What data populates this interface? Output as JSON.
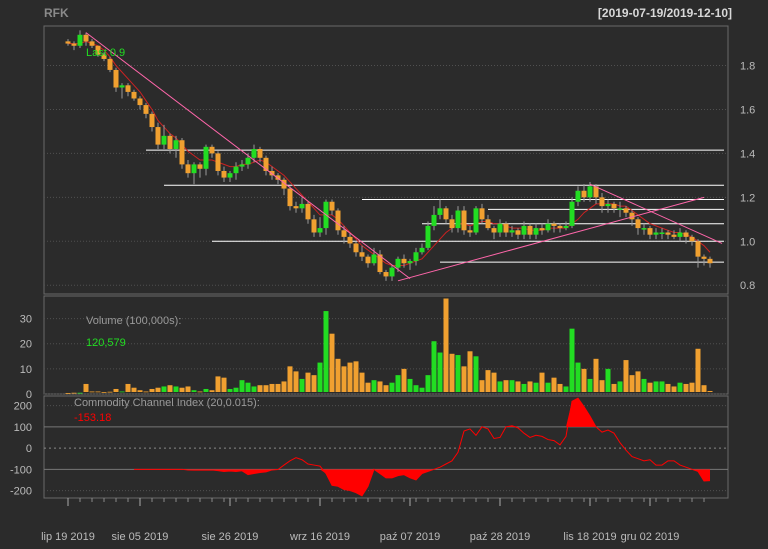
{
  "header": {
    "symbol": "RFK",
    "date_range": "[2019-07-19/2019-12-10]"
  },
  "colors": {
    "background": "#2b2b2b",
    "up": "#22dd22",
    "down": "#f0a030",
    "grid": "#505050",
    "axis_text": "#bbbbbb",
    "support_line": "#ffffff",
    "trend_line": "#ff66aa",
    "moving_average": "#cc2222",
    "cci_fill": "#ff0000"
  },
  "chart_data": [
    {
      "type": "candlestick",
      "panel": "price",
      "annotation": "Last 0.9",
      "y_ticks": [
        0.8,
        1.0,
        1.2,
        1.4,
        1.6,
        1.8
      ],
      "ylim": [
        0.76,
        1.98
      ],
      "grid": true,
      "x_tick_labels": [
        "lip 19 2019",
        "sie 05 2019",
        "sie 26 2019",
        "wrz 16 2019",
        "paź 07 2019",
        "paź 28 2019",
        "lis 18 2019",
        "gru 02 2019"
      ],
      "x_tick_index": [
        0,
        12,
        27,
        42,
        57,
        72,
        87,
        97
      ],
      "open": [
        1.91,
        1.9,
        1.89,
        1.94,
        1.91,
        1.89,
        1.85,
        1.83,
        1.78,
        1.7,
        1.71,
        1.68,
        1.65,
        1.62,
        1.58,
        1.52,
        1.44,
        1.48,
        1.42,
        1.46,
        1.35,
        1.31,
        1.35,
        1.33,
        1.43,
        1.4,
        1.32,
        1.29,
        1.31,
        1.34,
        1.35,
        1.38,
        1.42,
        1.38,
        1.32,
        1.3,
        1.28,
        1.24,
        1.16,
        1.15,
        1.17,
        1.1,
        1.04,
        1.06,
        1.18,
        1.14,
        1.05,
        1.02,
        0.99,
        0.95,
        0.93,
        0.9,
        0.94,
        0.86,
        0.84,
        0.88,
        0.92,
        0.9,
        0.91,
        0.95,
        0.97,
        1.07,
        1.12,
        1.15,
        1.1,
        1.06,
        1.14,
        1.05,
        1.04,
        1.15,
        1.1,
        1.06,
        1.04,
        1.08,
        1.04,
        1.05,
        1.03,
        1.07,
        1.03,
        1.06,
        1.05,
        1.08,
        1.07,
        1.06,
        1.07,
        1.18,
        1.23,
        1.2,
        1.25,
        1.2,
        1.16,
        1.17,
        1.15,
        1.15,
        1.13,
        1.1,
        1.06,
        1.06,
        1.03,
        1.04,
        1.04,
        1.03,
        1.02,
        1.04,
        1.02,
        1.0,
        0.93,
        0.92
      ],
      "high": [
        1.92,
        1.91,
        1.96,
        1.95,
        1.92,
        1.89,
        1.86,
        1.84,
        1.79,
        1.72,
        1.72,
        1.69,
        1.66,
        1.63,
        1.59,
        1.54,
        1.53,
        1.49,
        1.48,
        1.47,
        1.37,
        1.36,
        1.36,
        1.44,
        1.44,
        1.41,
        1.34,
        1.32,
        1.36,
        1.37,
        1.4,
        1.44,
        1.43,
        1.39,
        1.34,
        1.31,
        1.29,
        1.25,
        1.18,
        1.2,
        1.18,
        1.12,
        1.11,
        1.19,
        1.19,
        1.15,
        1.07,
        1.04,
        1.0,
        0.98,
        0.94,
        0.97,
        0.96,
        0.87,
        0.89,
        0.93,
        0.94,
        0.92,
        0.97,
        0.99,
        1.09,
        1.16,
        1.19,
        1.16,
        1.12,
        1.16,
        1.16,
        1.07,
        1.16,
        1.17,
        1.12,
        1.07,
        1.1,
        1.09,
        1.07,
        1.06,
        1.09,
        1.08,
        1.08,
        1.08,
        1.1,
        1.09,
        1.08,
        1.09,
        1.2,
        1.25,
        1.26,
        1.27,
        1.26,
        1.22,
        1.19,
        1.18,
        1.18,
        1.16,
        1.14,
        1.11,
        1.08,
        1.07,
        1.06,
        1.06,
        1.05,
        1.05,
        1.06,
        1.05,
        1.03,
        1.01,
        0.94,
        0.93
      ],
      "low": [
        1.89,
        1.87,
        1.88,
        1.89,
        1.88,
        1.84,
        1.82,
        1.77,
        1.68,
        1.65,
        1.66,
        1.64,
        1.6,
        1.56,
        1.5,
        1.42,
        1.42,
        1.4,
        1.38,
        1.33,
        1.29,
        1.26,
        1.29,
        1.3,
        1.38,
        1.3,
        1.27,
        1.27,
        1.28,
        1.32,
        1.33,
        1.36,
        1.36,
        1.3,
        1.28,
        1.26,
        1.21,
        1.14,
        1.13,
        1.13,
        1.08,
        1.02,
        1.02,
        1.03,
        1.12,
        1.03,
        0.99,
        0.97,
        0.93,
        0.91,
        0.88,
        0.89,
        0.85,
        0.82,
        0.82,
        0.86,
        0.88,
        0.87,
        0.89,
        0.94,
        0.96,
        1.05,
        1.1,
        1.08,
        1.04,
        1.04,
        1.03,
        1.02,
        1.03,
        1.08,
        1.05,
        1.01,
        1.02,
        1.02,
        1.02,
        1.01,
        1.01,
        1.01,
        1.01,
        1.03,
        1.04,
        1.04,
        1.04,
        1.05,
        1.06,
        1.16,
        1.18,
        1.18,
        1.17,
        1.13,
        1.13,
        1.13,
        1.11,
        1.11,
        1.07,
        1.03,
        1.03,
        1.01,
        1.01,
        1.01,
        1.01,
        1.01,
        1.0,
        0.99,
        0.98,
        0.88,
        0.89,
        0.88
      ],
      "close": [
        1.9,
        1.89,
        1.94,
        1.91,
        1.89,
        1.85,
        1.83,
        1.78,
        1.7,
        1.71,
        1.68,
        1.65,
        1.62,
        1.58,
        1.52,
        1.44,
        1.48,
        1.42,
        1.46,
        1.35,
        1.31,
        1.35,
        1.33,
        1.43,
        1.4,
        1.32,
        1.29,
        1.31,
        1.34,
        1.35,
        1.38,
        1.42,
        1.38,
        1.32,
        1.3,
        1.28,
        1.24,
        1.16,
        1.15,
        1.17,
        1.1,
        1.04,
        1.06,
        1.18,
        1.14,
        1.05,
        1.02,
        0.99,
        0.95,
        0.93,
        0.9,
        0.94,
        0.86,
        0.84,
        0.88,
        0.92,
        0.9,
        0.91,
        0.95,
        0.97,
        1.07,
        1.12,
        1.15,
        1.1,
        1.06,
        1.14,
        1.05,
        1.04,
        1.15,
        1.1,
        1.06,
        1.04,
        1.08,
        1.04,
        1.05,
        1.03,
        1.07,
        1.03,
        1.06,
        1.05,
        1.08,
        1.07,
        1.06,
        1.07,
        1.18,
        1.23,
        1.2,
        1.25,
        1.2,
        1.16,
        1.17,
        1.15,
        1.15,
        1.13,
        1.1,
        1.06,
        1.06,
        1.03,
        1.04,
        1.04,
        1.03,
        1.02,
        1.04,
        1.02,
        1.0,
        0.93,
        0.92,
        0.9
      ],
      "moving_average": [
        1.9,
        1.9,
        1.9,
        1.91,
        1.9,
        1.89,
        1.87,
        1.84,
        1.8,
        1.77,
        1.74,
        1.71,
        1.68,
        1.64,
        1.6,
        1.55,
        1.52,
        1.49,
        1.47,
        1.44,
        1.41,
        1.39,
        1.37,
        1.37,
        1.37,
        1.36,
        1.35,
        1.34,
        1.34,
        1.35,
        1.35,
        1.36,
        1.37,
        1.36,
        1.34,
        1.32,
        1.3,
        1.27,
        1.24,
        1.21,
        1.18,
        1.15,
        1.12,
        1.12,
        1.12,
        1.1,
        1.07,
        1.04,
        1.01,
        0.98,
        0.96,
        0.94,
        0.92,
        0.9,
        0.89,
        0.89,
        0.89,
        0.9,
        0.91,
        0.92,
        0.95,
        0.98,
        1.01,
        1.04,
        1.06,
        1.08,
        1.08,
        1.07,
        1.08,
        1.09,
        1.09,
        1.08,
        1.08,
        1.07,
        1.06,
        1.06,
        1.06,
        1.05,
        1.05,
        1.05,
        1.06,
        1.06,
        1.06,
        1.06,
        1.08,
        1.1,
        1.13,
        1.15,
        1.17,
        1.17,
        1.17,
        1.17,
        1.16,
        1.16,
        1.14,
        1.12,
        1.1,
        1.08,
        1.07,
        1.06,
        1.05,
        1.04,
        1.04,
        1.03,
        1.02,
        1.0,
        0.98,
        0.95
      ],
      "horizontal_levels": [
        {
          "y": 1.415,
          "from": 13
        },
        {
          "y": 1.255,
          "from": 16
        },
        {
          "y": 1.19,
          "from": 49
        },
        {
          "y": 1.145,
          "from": 70
        },
        {
          "y": 1.08,
          "from": 59
        },
        {
          "y": 1.0,
          "from": 24
        },
        {
          "y": 0.905,
          "from": 62
        }
      ],
      "trend_lines": [
        {
          "from": [
            3,
            1.95
          ],
          "to": [
            57,
            0.83
          ]
        },
        {
          "from": [
            55,
            0.82
          ],
          "to": [
            106,
            1.2
          ]
        },
        {
          "from": [
            87,
            1.26
          ],
          "to": [
            109,
            0.99
          ]
        }
      ]
    },
    {
      "type": "bar",
      "panel": "volume",
      "label": "Volume (100,000s):",
      "last_value": "120,579",
      "y_ticks": [
        0,
        10,
        20,
        30
      ],
      "ylim": [
        0,
        39
      ],
      "values": [
        0.4,
        0.5,
        0.5,
        4.0,
        1.0,
        1.0,
        0.8,
        0.9,
        2.0,
        1.0,
        4.0,
        2.5,
        1.5,
        1.0,
        2.0,
        2.5,
        3.0,
        3.5,
        3.0,
        2.5,
        3.0,
        1.5,
        1.0,
        2.0,
        1.5,
        7.0,
        6.5,
        2.0,
        2.5,
        5.5,
        4.5,
        3.0,
        3.5,
        3.5,
        4.0,
        4.0,
        5.0,
        11.0,
        9.0,
        6.0,
        8.5,
        7.5,
        12.5,
        33.0,
        24.0,
        14.0,
        11.0,
        12.5,
        13.0,
        8.5,
        4.5,
        5.5,
        5.0,
        3.5,
        4.5,
        7.5,
        10.0,
        6.0,
        3.5,
        2.5,
        7.5,
        21.0,
        16.5,
        38.0,
        16.0,
        15.5,
        11.0,
        17.0,
        15.0,
        5.5,
        9.5,
        8.5,
        5.0,
        5.5,
        5.5,
        5.0,
        4.0,
        5.0,
        4.5,
        8.5,
        4.5,
        6.5,
        4.0,
        3.0,
        26.0,
        12.5,
        10.0,
        6.0,
        14.0,
        5.5,
        10.0,
        4.0,
        5.0,
        13.5,
        7.5,
        9.0,
        6.0,
        4.5,
        5.0,
        5.0,
        4.0,
        3.0,
        4.5,
        4.0,
        4.5,
        18.0,
        3.5,
        1.2
      ]
    },
    {
      "type": "area",
      "panel": "cci",
      "label": "Commodity Channel Index (20,0.015):",
      "last_value": "-153.18",
      "y_ticks": [
        -200,
        -100,
        0,
        100,
        200
      ],
      "ylim": [
        -235,
        245
      ],
      "values": [
        -100,
        -100,
        -100,
        -100,
        -100,
        -100,
        -100,
        -100,
        -100,
        -103,
        -104,
        -104,
        -104,
        -103,
        -106,
        -110,
        -108,
        -110,
        -107,
        -125,
        -120,
        -115,
        -112,
        -103,
        -101,
        -80,
        -60,
        -45,
        -55,
        -75,
        -80,
        -85,
        -120,
        -175,
        -180,
        -195,
        -200,
        -210,
        -225,
        -180,
        -100,
        -120,
        -140,
        -140,
        -130,
        -125,
        -140,
        -150,
        -120,
        -110,
        -100,
        -90,
        -75,
        -60,
        -20,
        80,
        90,
        60,
        100,
        90,
        45,
        50,
        100,
        105,
        95,
        70,
        50,
        60,
        55,
        40,
        35,
        15,
        55,
        220,
        235,
        195,
        150,
        100,
        75,
        85,
        70,
        25,
        -10,
        -40,
        -50,
        -60,
        -55,
        -80,
        -80,
        -60,
        -60,
        -80,
        -90,
        -100,
        -110,
        -155,
        -153
      ]
    }
  ]
}
